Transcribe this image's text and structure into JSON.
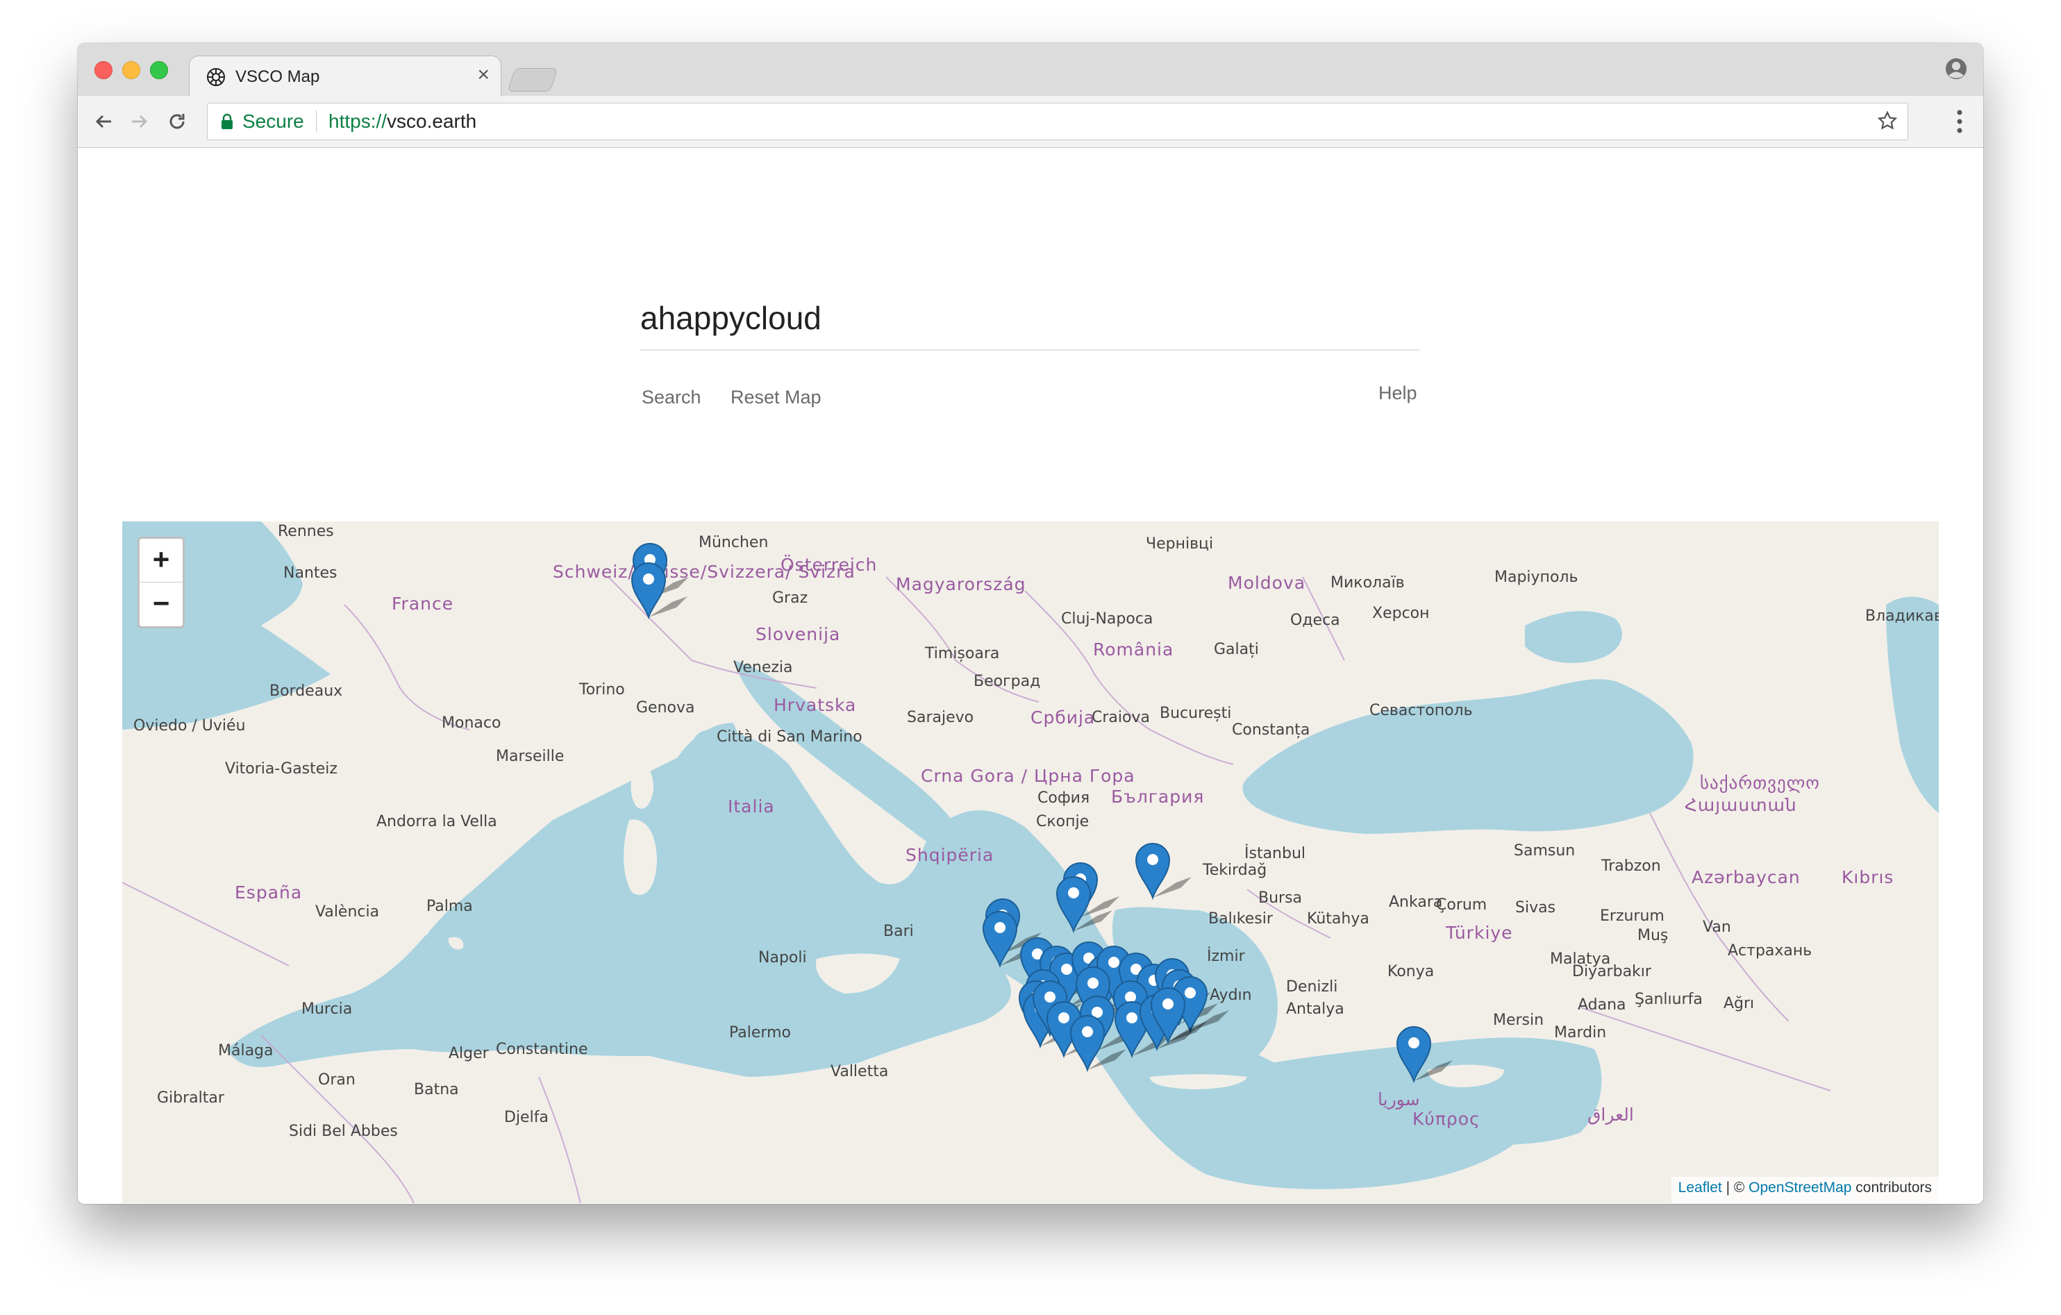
{
  "browser": {
    "tab_title": "VSCO Map",
    "tab_close": "×",
    "secure_label": "Secure",
    "url_scheme": "https://",
    "url_host": "vsco.earth"
  },
  "page": {
    "search_value": "ahappycloud",
    "search_link": "Search",
    "reset_link": "Reset Map",
    "help_link": "Help"
  },
  "map": {
    "zoom_in": "+",
    "zoom_out": "−",
    "attribution": {
      "leaflet": "Leaflet",
      "separator": " | © ",
      "osm": "OpenStreetMap",
      "suffix": " contributors"
    },
    "labels": [
      {
        "text": "Rennes",
        "type": "city"
      },
      {
        "text": "Nantes",
        "type": "city"
      },
      {
        "text": "France",
        "type": "country"
      },
      {
        "text": "Bordeaux",
        "type": "city"
      },
      {
        "text": "Oviedo / Uviéu",
        "type": "city"
      },
      {
        "text": "Vitoria-Gasteiz",
        "type": "city"
      },
      {
        "text": "España",
        "type": "country"
      },
      {
        "text": "Andorra la Vella",
        "type": "city"
      },
      {
        "text": "València",
        "type": "city"
      },
      {
        "text": "Palma",
        "type": "city"
      },
      {
        "text": "Murcia",
        "type": "city"
      },
      {
        "text": "Málaga",
        "type": "city"
      },
      {
        "text": "Gibraltar",
        "type": "city"
      },
      {
        "text": "Oran",
        "type": "city"
      },
      {
        "text": "Sidi Bel Abbes",
        "type": "city"
      },
      {
        "text": "Alger",
        "type": "city"
      },
      {
        "text": "Djelfa",
        "type": "city"
      },
      {
        "text": "Batna",
        "type": "city"
      },
      {
        "text": "Constantine",
        "type": "city"
      },
      {
        "text": "Marseille",
        "type": "city"
      },
      {
        "text": "Monaco",
        "type": "city"
      },
      {
        "text": "Torino",
        "type": "city"
      },
      {
        "text": "Genova",
        "type": "city"
      },
      {
        "text": "München",
        "type": "city"
      },
      {
        "text": "Österreich",
        "type": "country"
      },
      {
        "text": "Schweiz/ Suisse/Svizzera/ Svizra",
        "type": "country"
      },
      {
        "text": "Graz",
        "type": "city"
      },
      {
        "text": "Slovenija",
        "type": "country"
      },
      {
        "text": "Venezia",
        "type": "city"
      },
      {
        "text": "Hrvatska",
        "type": "country"
      },
      {
        "text": "Città di San Marino",
        "type": "city"
      },
      {
        "text": "Italia",
        "type": "country"
      },
      {
        "text": "Napoli",
        "type": "city"
      },
      {
        "text": "Bari",
        "type": "city"
      },
      {
        "text": "Palermo",
        "type": "city"
      },
      {
        "text": "Valletta",
        "type": "city"
      },
      {
        "text": "Magyarország",
        "type": "country"
      },
      {
        "text": "Timișoara",
        "type": "city"
      },
      {
        "text": "Cluj-Napoca",
        "type": "city"
      },
      {
        "text": "România",
        "type": "country"
      },
      {
        "text": "Београд",
        "type": "city"
      },
      {
        "text": "Србија",
        "type": "country"
      },
      {
        "text": "Sarajevo",
        "type": "city"
      },
      {
        "text": "Crna Gora / Црна Гора",
        "type": "country"
      },
      {
        "text": "Craiova",
        "type": "city"
      },
      {
        "text": "București",
        "type": "city"
      },
      {
        "text": "България",
        "type": "country"
      },
      {
        "text": "София",
        "type": "city"
      },
      {
        "text": "Скопје",
        "type": "city"
      },
      {
        "text": "Shqipëria",
        "type": "country"
      },
      {
        "text": "Moldova",
        "type": "country"
      },
      {
        "text": "Galați",
        "type": "city"
      },
      {
        "text": "Constanța",
        "type": "city"
      },
      {
        "text": "Чернівці",
        "type": "city"
      },
      {
        "text": "Миколаїв",
        "type": "city"
      },
      {
        "text": "Одеса",
        "type": "city"
      },
      {
        "text": "Херсон",
        "type": "city"
      },
      {
        "text": "Маріуполь",
        "type": "city"
      },
      {
        "text": "Севастополь",
        "type": "city"
      },
      {
        "text": "İstanbul",
        "type": "city"
      },
      {
        "text": "Tekirdağ",
        "type": "city"
      },
      {
        "text": "Bursa",
        "type": "city"
      },
      {
        "text": "Balıkesir",
        "type": "city"
      },
      {
        "text": "Kütahya",
        "type": "city"
      },
      {
        "text": "İzmir",
        "type": "city"
      },
      {
        "text": "Aydın",
        "type": "city"
      },
      {
        "text": "Denizli",
        "type": "city"
      },
      {
        "text": "Antalya",
        "type": "city"
      },
      {
        "text": "Ankara",
        "type": "city"
      },
      {
        "text": "Çorum",
        "type": "city"
      },
      {
        "text": "Türkiye",
        "type": "country"
      },
      {
        "text": "Konya",
        "type": "city"
      },
      {
        "text": "Sivas",
        "type": "city"
      },
      {
        "text": "Samsun",
        "type": "city"
      },
      {
        "text": "Trabzon",
        "type": "city"
      },
      {
        "text": "Erzurum",
        "type": "city"
      },
      {
        "text": "Muş",
        "type": "city"
      },
      {
        "text": "Malatya",
        "type": "city"
      },
      {
        "text": "Diyarbakır",
        "type": "city"
      },
      {
        "text": "Şanlıurfa",
        "type": "city"
      },
      {
        "text": "Adana",
        "type": "city"
      },
      {
        "text": "Mersin",
        "type": "city"
      },
      {
        "text": "Mardin",
        "type": "city"
      },
      {
        "text": "Ağrı",
        "type": "city"
      },
      {
        "text": "Van",
        "type": "city"
      },
      {
        "text": "Астрахань",
        "type": "city"
      },
      {
        "text": "Владикавказ",
        "type": "city"
      },
      {
        "text": "საქართველო",
        "type": "country"
      },
      {
        "text": "Հայաստան",
        "type": "country"
      },
      {
        "text": "Azərbaycan",
        "type": "country"
      },
      {
        "text": "Kıbrıs",
        "type": "country"
      },
      {
        "text": "Κύπρος",
        "type": "country"
      },
      {
        "text": "سوريا",
        "type": "country"
      },
      {
        "text": "العراق",
        "type": "country"
      }
    ]
  }
}
